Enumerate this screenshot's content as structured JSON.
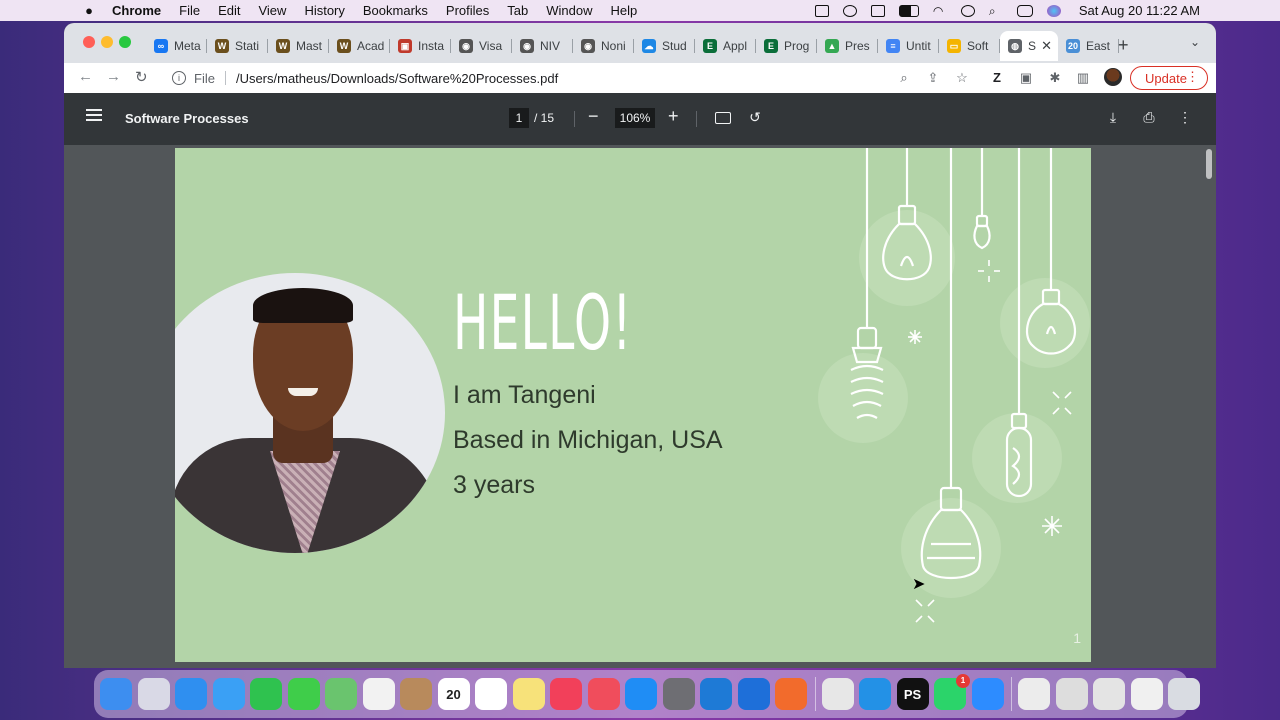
{
  "menubar": {
    "app": "Chrome",
    "items": [
      "File",
      "Edit",
      "View",
      "History",
      "Bookmarks",
      "Profiles",
      "Tab",
      "Window",
      "Help"
    ],
    "clock": "Sat Aug 20  11:22 AM"
  },
  "tabs": [
    {
      "label": "Meta",
      "color": "#1877f2",
      "glyph": "∞"
    },
    {
      "label": "Stati",
      "color": "#6b4f1d",
      "glyph": "W"
    },
    {
      "label": "Mast",
      "color": "#6b4f1d",
      "glyph": "W"
    },
    {
      "label": "Acad",
      "color": "#6b4f1d",
      "glyph": "W"
    },
    {
      "label": "Insta",
      "color": "#c0392b",
      "glyph": "▣"
    },
    {
      "label": "Visa",
      "color": "#555555",
      "glyph": "◉"
    },
    {
      "label": "NIV",
      "color": "#555555",
      "glyph": "◉"
    },
    {
      "label": "Noni",
      "color": "#555555",
      "glyph": "◉"
    },
    {
      "label": "Stud",
      "color": "#1e88e5",
      "glyph": "☁"
    },
    {
      "label": "Appl",
      "color": "#0b6e3a",
      "glyph": "E"
    },
    {
      "label": "Prog",
      "color": "#0b6e3a",
      "glyph": "E"
    },
    {
      "label": "Pres",
      "color": "#34a853",
      "glyph": "▲"
    },
    {
      "label": "Untit",
      "color": "#4285f4",
      "glyph": "≡"
    },
    {
      "label": "Soft",
      "color": "#f4b400",
      "glyph": "▭"
    },
    {
      "label": "S",
      "color": "#5f6368",
      "glyph": "◍",
      "active": true
    },
    {
      "label": "East",
      "color": "#4a8fd6",
      "glyph": "20"
    }
  ],
  "toolbar": {
    "scheme": "File",
    "url": "/Users/matheus/Downloads/Software%20Processes.pdf",
    "update_label": "Update"
  },
  "pdf": {
    "title": "Software Processes",
    "current_page": "1",
    "total_pages": "/ 15",
    "zoom": "106%"
  },
  "slide": {
    "heading": "HELLO!",
    "lines": [
      "I am Tangeni",
      "Based in Michigan, USA",
      "3 years"
    ],
    "page_number": "1"
  },
  "colors": {
    "slide_bg": "#b3d4a8",
    "pdf_toolbar": "#323639",
    "update_red": "#d93025"
  },
  "dock": [
    {
      "name": "finder",
      "color": "#3d8ef0"
    },
    {
      "name": "launchpad",
      "color": "#d9d9e6"
    },
    {
      "name": "safari",
      "color": "#2f8ff0"
    },
    {
      "name": "mail",
      "color": "#3aa0f5"
    },
    {
      "name": "facetime",
      "color": "#2fc24f"
    },
    {
      "name": "messages",
      "color": "#3fcd4a"
    },
    {
      "name": "maps",
      "color": "#6ac46e"
    },
    {
      "name": "photos",
      "color": "#f2f2f2"
    },
    {
      "name": "contacts",
      "color": "#b88a5c"
    },
    {
      "name": "calendar",
      "color": "#ffffff",
      "text": "20"
    },
    {
      "name": "reminders",
      "color": "#ffffff"
    },
    {
      "name": "notes",
      "color": "#f7e27a"
    },
    {
      "name": "music",
      "color": "#f2405a"
    },
    {
      "name": "news",
      "color": "#f04d5c"
    },
    {
      "name": "app-store",
      "color": "#1f8df5"
    },
    {
      "name": "system-preferences",
      "color": "#6e6e73"
    },
    {
      "name": "vscode",
      "color": "#1e7ad6"
    },
    {
      "name": "teamviewer",
      "color": "#1e6fd9"
    },
    {
      "name": "pen-app",
      "color": "#f26b2c"
    },
    {
      "name": "sep"
    },
    {
      "name": "chrome",
      "color": "#e7e7e7"
    },
    {
      "name": "docker",
      "color": "#2391e6"
    },
    {
      "name": "phpstorm",
      "color": "#111111",
      "text": "PS"
    },
    {
      "name": "whatsapp",
      "color": "#2bd46a",
      "badge": "1"
    },
    {
      "name": "zoom",
      "color": "#2d8cff"
    },
    {
      "name": "sep"
    },
    {
      "name": "window-1",
      "color": "#ececec"
    },
    {
      "name": "window-2",
      "color": "#dddddd"
    },
    {
      "name": "window-3",
      "color": "#e4e4e4"
    },
    {
      "name": "window-4",
      "color": "#f0f0f0"
    },
    {
      "name": "trash",
      "color": "#d9dce2"
    }
  ]
}
